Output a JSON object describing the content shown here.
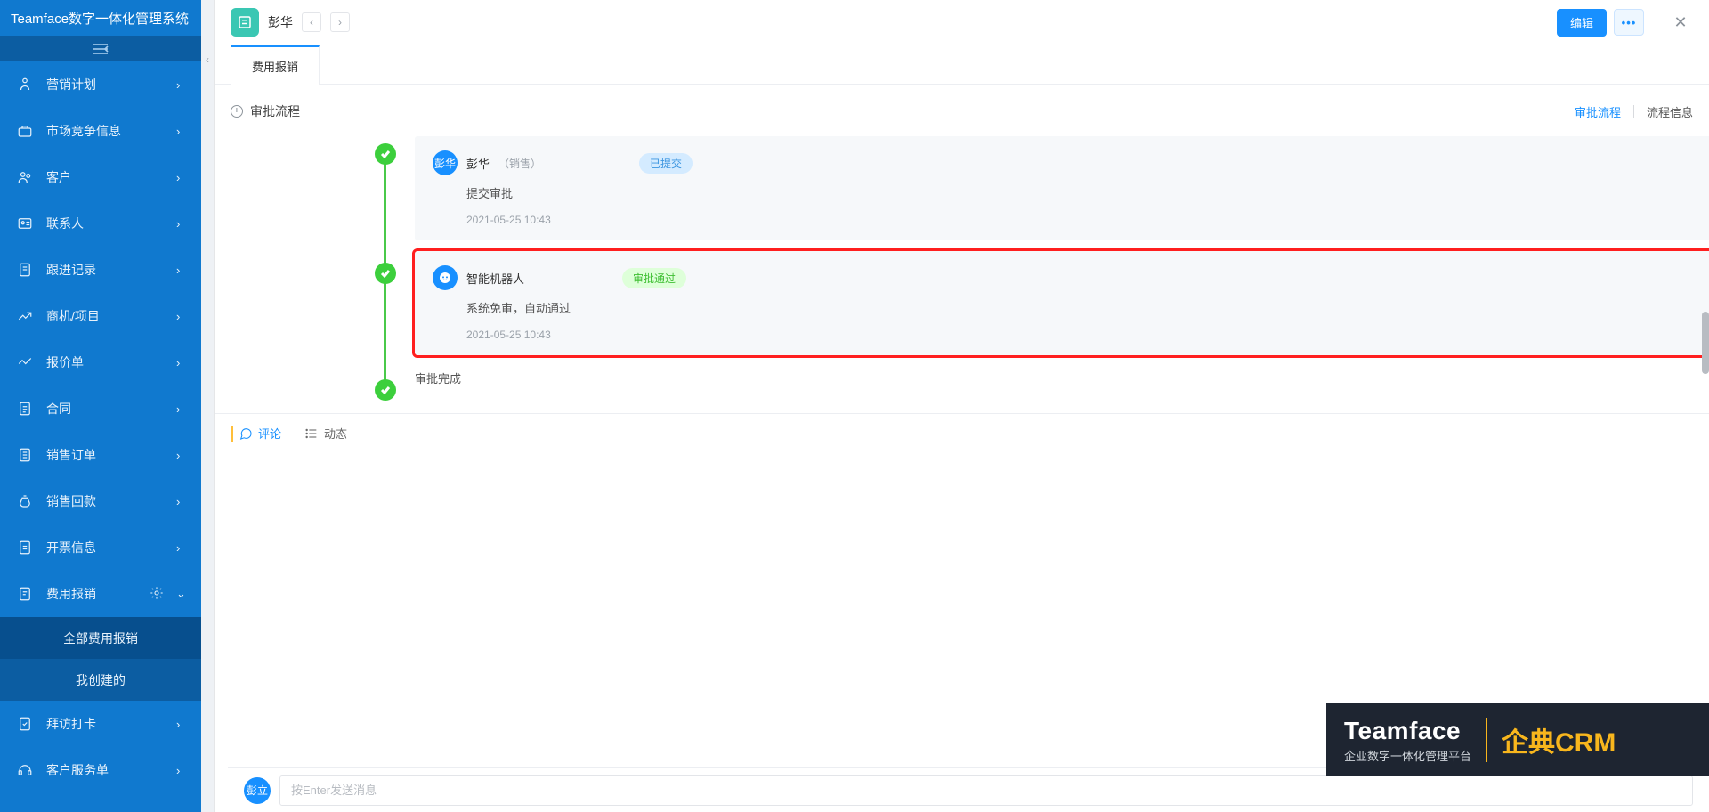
{
  "app_title": "Teamface数字一体化管理系统",
  "sidebar": [
    {
      "label": "营销计划"
    },
    {
      "label": "市场竞争信息"
    },
    {
      "label": "客户"
    },
    {
      "label": "联系人"
    },
    {
      "label": "跟进记录"
    },
    {
      "label": "商机/项目"
    },
    {
      "label": "报价单"
    },
    {
      "label": "合同"
    },
    {
      "label": "销售订单"
    },
    {
      "label": "销售回款"
    },
    {
      "label": "开票信息"
    },
    {
      "label": "费用报销"
    },
    {
      "label": "拜访打卡"
    },
    {
      "label": "客户服务单"
    }
  ],
  "sub": {
    "a": "全部费用报销",
    "b": "我创建的"
  },
  "record": {
    "name": "彭华"
  },
  "buttons": {
    "edit": "编辑"
  },
  "tab": "费用报销",
  "section": {
    "title": "审批流程",
    "link1": "审批流程",
    "link2": "流程信息"
  },
  "steps": [
    {
      "name": "彭华",
      "role": "（销售）",
      "tag": "已提交",
      "tagClass": "blue",
      "sub": "提交审批",
      "time": "2021-05-25 10:43",
      "av": "彭华",
      "avBg": "#1890ff"
    },
    {
      "name": "智能机器人",
      "role": "",
      "tag": "审批通过",
      "tagClass": "green",
      "sub": "系统免审，自动通过",
      "time": "2021-05-25 10:43",
      "av": "bot",
      "avBg": "#1890ff"
    }
  ],
  "done": "审批完成",
  "ctabs": {
    "comment": "评论",
    "activity": "动态"
  },
  "composer": {
    "av": "彭立",
    "placeholder": "按Enter发送消息"
  },
  "wm": {
    "t": "Teamface",
    "s": "企业数字一体化管理平台",
    "r": "企典CRM"
  }
}
